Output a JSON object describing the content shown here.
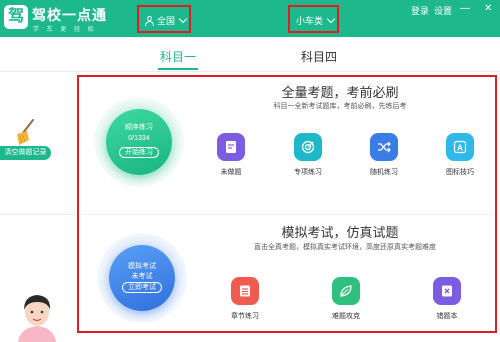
{
  "header": {
    "logo_char": "驾",
    "brand": "驾校一点通",
    "brand_sub": "学 车 更 轻 松",
    "region": "全国",
    "vehicle": "小车类",
    "login": "登录",
    "settings": "设置",
    "minimize": "—",
    "close": "✕",
    "bg_color": "#1db98c"
  },
  "tabs": [
    {
      "label": "科目一",
      "active": true
    },
    {
      "label": "科目四",
      "active": false
    }
  ],
  "left": {
    "clear_label": "清空做题记录"
  },
  "section1": {
    "headline": "全量考题，考前必刷",
    "subline": "科目一全新考试题库，考前必刷，先练后考",
    "circle_title": "顺序练习",
    "circle_count": "0/1334",
    "circle_button": "开始练习",
    "features": [
      {
        "label": "未做题",
        "icon": "document-icon",
        "color": "#7c5ce0"
      },
      {
        "label": "专项练习",
        "icon": "target-icon",
        "color": "#1fb8c9"
      },
      {
        "label": "随机练习",
        "icon": "shuffle-icon",
        "color": "#3b7de6"
      },
      {
        "label": "图标技巧",
        "icon": "image-a-icon",
        "color": "#2fb8e8"
      }
    ]
  },
  "section2": {
    "headline": "模拟考试，仿真试题",
    "subline": "直击全真考题，模拟真实考试环境，高度还原真实考题难度",
    "circle_title": "模拟考试",
    "circle_status": "未考试",
    "circle_button": "立即考试",
    "features": [
      {
        "label": "章节练习",
        "icon": "list-icon",
        "color": "#f05a50"
      },
      {
        "label": "难题攻克",
        "icon": "leaf-icon",
        "color": "#2fbf7e"
      },
      {
        "label": "错题本",
        "icon": "x-note-icon",
        "color": "#7c5ce0"
      }
    ]
  }
}
